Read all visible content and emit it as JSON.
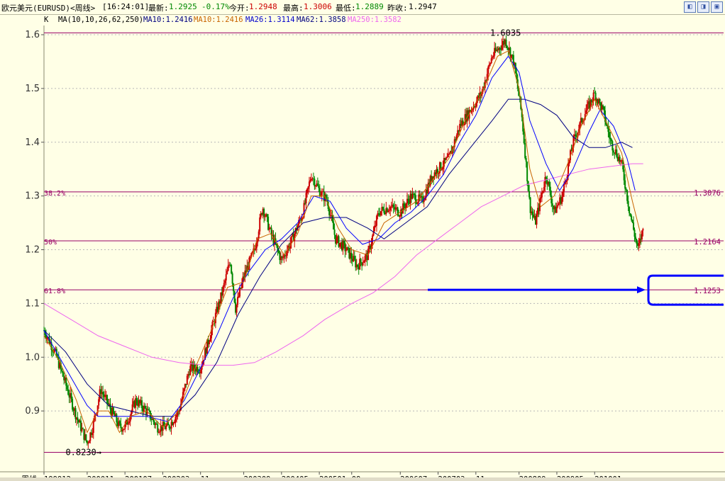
{
  "header": {
    "symbol": "欧元美元(EURUSD)<周线>",
    "time": "[16:24:01]",
    "latest_label": "最新:",
    "latest_value": "1.2925",
    "change": "-0.17%",
    "open_label": "今开:",
    "open_value": "1.2948",
    "high_label": "最高:",
    "high_value": "1.3006",
    "low_label": "最低:",
    "low_value": "1.2889",
    "prev_label": "昨收:",
    "prev_value": "1.2947"
  },
  "ma_bar": {
    "k": "K",
    "params": "MA(10,10,26,62,250)",
    "ma10a": "MA10:1.2416",
    "ma10b": "MA10:1.2416",
    "ma26": "MA26:1.3114",
    "ma62": "MA62:1.3858",
    "ma250": "MA250:1.3582"
  },
  "window_buttons": [
    "◧",
    "◨",
    "▣"
  ],
  "colors": {
    "background": "#ffffe6",
    "up": "#cc0000",
    "down": "#008800",
    "ma10": "#c86400",
    "ma26": "#0000ff",
    "ma62": "#000080",
    "ma250": "#ee66ee",
    "fib_line": "#990066",
    "annotation": "#0000ff"
  },
  "chart_data": {
    "type": "candlestick",
    "period_label": "周线",
    "y_ticks": [
      0.9,
      1.0,
      1.1,
      1.2,
      1.3,
      1.4,
      1.5,
      1.6
    ],
    "ylim": [
      0.8,
      1.6
    ],
    "x_ticks": [
      {
        "label": "199912",
        "t": 0
      },
      {
        "label": "200011",
        "t": 0.8
      },
      {
        "label": "200107",
        "t": 1.5
      },
      {
        "label": "200203",
        "t": 2.2
      },
      {
        "label": "11",
        "t": 2.9
      },
      {
        "label": "200309",
        "t": 3.7
      },
      {
        "label": "200405",
        "t": 4.4
      },
      {
        "label": "200501",
        "t": 5.1
      },
      {
        "label": "09",
        "t": 5.7
      },
      {
        "label": "200607",
        "t": 6.6
      },
      {
        "label": "200703",
        "t": 7.3
      },
      {
        "label": "11",
        "t": 8.0
      },
      {
        "label": "200809",
        "t": 8.8
      },
      {
        "label": "200905",
        "t": 9.5
      },
      {
        "label": "201001",
        "t": 10.2
      }
    ],
    "t_range": [
      0,
      11.8
    ],
    "fib_levels": [
      {
        "label": "",
        "value": 1.6035
      },
      {
        "label": "38.2%",
        "value": 1.3076,
        "value_label": "1.3076"
      },
      {
        "label": "50%",
        "value": 1.2164,
        "value_label": "1.2164"
      },
      {
        "label": "61.8%",
        "value": 1.1253,
        "value_label": "1.1253"
      },
      {
        "label": "",
        "value": 0.823
      }
    ],
    "annotations": [
      {
        "text": "1.6035",
        "t": 8.55,
        "value": 1.6035
      },
      {
        "text": "0.8230→",
        "t": 0.4,
        "value": 0.823
      }
    ],
    "price_path": [
      [
        0,
        1.05
      ],
      [
        0.2,
        1.01
      ],
      [
        0.4,
        0.95
      ],
      [
        0.6,
        0.89
      ],
      [
        0.8,
        0.84
      ],
      [
        0.9,
        0.87
      ],
      [
        1.05,
        0.94
      ],
      [
        1.2,
        0.91
      ],
      [
        1.4,
        0.87
      ],
      [
        1.5,
        0.87
      ],
      [
        1.7,
        0.92
      ],
      [
        1.9,
        0.9
      ],
      [
        2.1,
        0.87
      ],
      [
        2.3,
        0.87
      ],
      [
        2.5,
        0.9
      ],
      [
        2.7,
        0.98
      ],
      [
        2.9,
        0.98
      ],
      [
        3.1,
        1.05
      ],
      [
        3.3,
        1.12
      ],
      [
        3.45,
        1.18
      ],
      [
        3.55,
        1.09
      ],
      [
        3.7,
        1.15
      ],
      [
        3.9,
        1.2
      ],
      [
        4.05,
        1.28
      ],
      [
        4.2,
        1.23
      ],
      [
        4.4,
        1.18
      ],
      [
        4.6,
        1.22
      ],
      [
        4.8,
        1.27
      ],
      [
        4.95,
        1.34
      ],
      [
        5.1,
        1.31
      ],
      [
        5.25,
        1.29
      ],
      [
        5.4,
        1.22
      ],
      [
        5.6,
        1.2
      ],
      [
        5.8,
        1.17
      ],
      [
        6.0,
        1.19
      ],
      [
        6.2,
        1.27
      ],
      [
        6.4,
        1.28
      ],
      [
        6.6,
        1.27
      ],
      [
        6.8,
        1.3
      ],
      [
        7.0,
        1.29
      ],
      [
        7.2,
        1.34
      ],
      [
        7.5,
        1.37
      ],
      [
        7.7,
        1.43
      ],
      [
        7.9,
        1.46
      ],
      [
        8.1,
        1.49
      ],
      [
        8.3,
        1.56
      ],
      [
        8.55,
        1.59
      ],
      [
        8.7,
        1.55
      ],
      [
        8.85,
        1.45
      ],
      [
        9.0,
        1.28
      ],
      [
        9.1,
        1.25
      ],
      [
        9.3,
        1.34
      ],
      [
        9.45,
        1.27
      ],
      [
        9.6,
        1.3
      ],
      [
        9.8,
        1.4
      ],
      [
        10.0,
        1.45
      ],
      [
        10.2,
        1.49
      ],
      [
        10.35,
        1.46
      ],
      [
        10.5,
        1.4
      ],
      [
        10.7,
        1.36
      ],
      [
        10.85,
        1.27
      ],
      [
        11.0,
        1.2
      ],
      [
        11.1,
        1.24
      ]
    ],
    "ma10_path": [
      [
        0,
        1.04
      ],
      [
        0.3,
        0.99
      ],
      [
        0.6,
        0.92
      ],
      [
        0.8,
        0.86
      ],
      [
        1.0,
        0.9
      ],
      [
        1.2,
        0.9
      ],
      [
        1.4,
        0.86
      ],
      [
        1.6,
        0.89
      ],
      [
        1.9,
        0.9
      ],
      [
        2.2,
        0.87
      ],
      [
        2.5,
        0.9
      ],
      [
        2.8,
        0.98
      ],
      [
        3.1,
        1.05
      ],
      [
        3.4,
        1.13
      ],
      [
        3.7,
        1.14
      ],
      [
        3.95,
        1.22
      ],
      [
        4.2,
        1.23
      ],
      [
        4.45,
        1.19
      ],
      [
        4.7,
        1.23
      ],
      [
        4.95,
        1.3
      ],
      [
        5.2,
        1.3
      ],
      [
        5.45,
        1.24
      ],
      [
        5.7,
        1.2
      ],
      [
        6.0,
        1.19
      ],
      [
        6.3,
        1.25
      ],
      [
        6.6,
        1.27
      ],
      [
        6.9,
        1.29
      ],
      [
        7.2,
        1.33
      ],
      [
        7.5,
        1.37
      ],
      [
        7.8,
        1.44
      ],
      [
        8.1,
        1.49
      ],
      [
        8.4,
        1.56
      ],
      [
        8.6,
        1.57
      ],
      [
        8.8,
        1.5
      ],
      [
        9.0,
        1.35
      ],
      [
        9.2,
        1.28
      ],
      [
        9.45,
        1.3
      ],
      [
        9.7,
        1.36
      ],
      [
        9.95,
        1.43
      ],
      [
        10.2,
        1.48
      ],
      [
        10.45,
        1.43
      ],
      [
        10.7,
        1.38
      ],
      [
        10.9,
        1.29
      ],
      [
        11.05,
        1.23
      ]
    ],
    "ma26_path": [
      [
        0,
        1.05
      ],
      [
        0.4,
        0.98
      ],
      [
        0.8,
        0.91
      ],
      [
        1.0,
        0.89
      ],
      [
        1.3,
        0.89
      ],
      [
        1.6,
        0.89
      ],
      [
        1.9,
        0.89
      ],
      [
        2.3,
        0.88
      ],
      [
        2.6,
        0.92
      ],
      [
        2.9,
        0.98
      ],
      [
        3.2,
        1.04
      ],
      [
        3.5,
        1.11
      ],
      [
        3.8,
        1.16
      ],
      [
        4.1,
        1.2
      ],
      [
        4.4,
        1.22
      ],
      [
        4.7,
        1.25
      ],
      [
        5.0,
        1.3
      ],
      [
        5.3,
        1.29
      ],
      [
        5.6,
        1.24
      ],
      [
        5.9,
        1.21
      ],
      [
        6.2,
        1.22
      ],
      [
        6.5,
        1.25
      ],
      [
        6.8,
        1.27
      ],
      [
        7.1,
        1.3
      ],
      [
        7.4,
        1.34
      ],
      [
        7.7,
        1.4
      ],
      [
        8.0,
        1.45
      ],
      [
        8.3,
        1.52
      ],
      [
        8.6,
        1.56
      ],
      [
        8.8,
        1.53
      ],
      [
        9.0,
        1.44
      ],
      [
        9.3,
        1.36
      ],
      [
        9.55,
        1.31
      ],
      [
        9.8,
        1.35
      ],
      [
        10.1,
        1.42
      ],
      [
        10.3,
        1.46
      ],
      [
        10.55,
        1.43
      ],
      [
        10.8,
        1.37
      ],
      [
        10.95,
        1.31
      ]
    ],
    "ma62_path": [
      [
        0,
        1.05
      ],
      [
        0.4,
        1.01
      ],
      [
        0.8,
        0.95
      ],
      [
        1.2,
        0.91
      ],
      [
        1.6,
        0.9
      ],
      [
        2.0,
        0.89
      ],
      [
        2.4,
        0.89
      ],
      [
        2.8,
        0.93
      ],
      [
        3.2,
        0.99
      ],
      [
        3.6,
        1.08
      ],
      [
        4.0,
        1.15
      ],
      [
        4.4,
        1.21
      ],
      [
        4.8,
        1.25
      ],
      [
        5.2,
        1.26
      ],
      [
        5.6,
        1.26
      ],
      [
        6.0,
        1.24
      ],
      [
        6.3,
        1.22
      ],
      [
        6.7,
        1.25
      ],
      [
        7.1,
        1.28
      ],
      [
        7.5,
        1.34
      ],
      [
        7.9,
        1.39
      ],
      [
        8.3,
        1.44
      ],
      [
        8.6,
        1.48
      ],
      [
        8.9,
        1.48
      ],
      [
        9.2,
        1.47
      ],
      [
        9.5,
        1.45
      ],
      [
        9.8,
        1.41
      ],
      [
        10.1,
        1.39
      ],
      [
        10.4,
        1.39
      ],
      [
        10.7,
        1.4
      ],
      [
        10.9,
        1.39
      ]
    ],
    "ma250_path": [
      [
        0,
        1.1
      ],
      [
        0.5,
        1.07
      ],
      [
        1.0,
        1.04
      ],
      [
        1.5,
        1.02
      ],
      [
        2.0,
        1.0
      ],
      [
        2.5,
        0.99
      ],
      [
        3.0,
        0.985
      ],
      [
        3.5,
        0.985
      ],
      [
        3.9,
        0.99
      ],
      [
        4.3,
        1.01
      ],
      [
        4.8,
        1.04
      ],
      [
        5.2,
        1.07
      ],
      [
        5.7,
        1.1
      ],
      [
        6.1,
        1.12
      ],
      [
        6.5,
        1.15
      ],
      [
        6.9,
        1.19
      ],
      [
        7.3,
        1.22
      ],
      [
        7.7,
        1.25
      ],
      [
        8.1,
        1.28
      ],
      [
        8.5,
        1.3
      ],
      [
        8.9,
        1.32
      ],
      [
        9.3,
        1.33
      ],
      [
        9.7,
        1.34
      ],
      [
        10.1,
        1.35
      ],
      [
        10.5,
        1.355
      ],
      [
        10.9,
        1.36
      ],
      [
        11.1,
        1.36
      ]
    ]
  }
}
